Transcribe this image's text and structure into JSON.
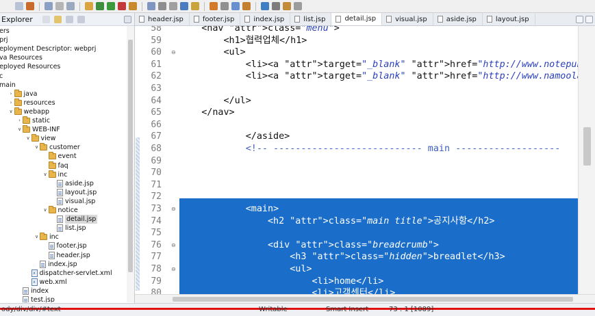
{
  "explorer": {
    "title": "Explorer",
    "tree": [
      {
        "label": "ers",
        "indent": 0,
        "kind": "none"
      },
      {
        "label": "prj",
        "indent": 0,
        "kind": "none"
      },
      {
        "label": "eployment Descriptor: webprj",
        "indent": 0,
        "kind": "none"
      },
      {
        "label": "va Resources",
        "indent": 0,
        "kind": "none"
      },
      {
        "label": "eployed Resources",
        "indent": 0,
        "kind": "none"
      },
      {
        "label": "c",
        "indent": 0,
        "kind": "none"
      },
      {
        "label": "main",
        "indent": 0,
        "kind": "none"
      },
      {
        "label": "java",
        "indent": 1,
        "kind": "folder"
      },
      {
        "label": "resources",
        "indent": 1,
        "kind": "folder"
      },
      {
        "label": "webapp",
        "indent": 1,
        "kind": "folder-open"
      },
      {
        "label": "static",
        "indent": 2,
        "kind": "folder"
      },
      {
        "label": "WEB-INF",
        "indent": 2,
        "kind": "folder-open"
      },
      {
        "label": "view",
        "indent": 3,
        "kind": "folder-open"
      },
      {
        "label": "customer",
        "indent": 4,
        "kind": "folder-open"
      },
      {
        "label": "event",
        "indent": 5,
        "kind": "folder-leaf"
      },
      {
        "label": "faq",
        "indent": 5,
        "kind": "folder-leaf"
      },
      {
        "label": "inc",
        "indent": 5,
        "kind": "folder-open"
      },
      {
        "label": "aside.jsp",
        "indent": 6,
        "kind": "file"
      },
      {
        "label": "layout.jsp",
        "indent": 6,
        "kind": "file"
      },
      {
        "label": "visual.jsp",
        "indent": 6,
        "kind": "file"
      },
      {
        "label": "notice",
        "indent": 5,
        "kind": "folder-open"
      },
      {
        "label": "detail.jsp",
        "indent": 6,
        "kind": "file",
        "selected": true
      },
      {
        "label": "list.jsp",
        "indent": 6,
        "kind": "file"
      },
      {
        "label": "inc",
        "indent": 4,
        "kind": "folder-open"
      },
      {
        "label": "footer.jsp",
        "indent": 5,
        "kind": "file"
      },
      {
        "label": "header.jsp",
        "indent": 5,
        "kind": "file"
      },
      {
        "label": "index.jsp",
        "indent": 4,
        "kind": "file"
      },
      {
        "label": "dispatcher-servlet.xml",
        "indent": 3,
        "kind": "xml"
      },
      {
        "label": "web.xml",
        "indent": 3,
        "kind": "xml"
      },
      {
        "label": "index",
        "indent": 2,
        "kind": "file"
      },
      {
        "label": "test.jsp",
        "indent": 2,
        "kind": "file"
      }
    ]
  },
  "tabs": [
    {
      "label": "header.jsp"
    },
    {
      "label": "footer.jsp"
    },
    {
      "label": "index.jsp"
    },
    {
      "label": "list.jsp"
    },
    {
      "label": "detail.jsp",
      "active": true
    },
    {
      "label": "visual.jsp"
    },
    {
      "label": "aside.jsp"
    },
    {
      "label": "layout.jsp"
    }
  ],
  "editor": {
    "lines": [
      {
        "num": "58",
        "text": "    <nav class=\"menu\">"
      },
      {
        "num": "59",
        "text": "        <h1>협력업체</h1>"
      },
      {
        "num": "60",
        "text": "        <ul>",
        "fold": true
      },
      {
        "num": "61",
        "text": "            <li><a target=\"_blank\" href=\"http://www.notepubs.com\"><im"
      },
      {
        "num": "62",
        "text": "            <li><a target=\"_blank\" href=\"http://www.namoolab.com\"><im"
      },
      {
        "num": "63",
        "text": ""
      },
      {
        "num": "64",
        "text": "        </ul>"
      },
      {
        "num": "65",
        "text": "    </nav>"
      },
      {
        "num": "66",
        "text": ""
      },
      {
        "num": "67",
        "text": "            </aside>"
      },
      {
        "num": "68",
        "text": "            <!-- --------------------------- main -------------------"
      },
      {
        "num": "69",
        "text": ""
      },
      {
        "num": "70",
        "text": ""
      },
      {
        "num": "71",
        "text": ""
      },
      {
        "num": "72",
        "text": ""
      },
      {
        "num": "73",
        "text": "            <main>",
        "fold": true,
        "selected": true
      },
      {
        "num": "74",
        "text": "                <h2 class=\"main title\">공지사항</h2>",
        "selected": true
      },
      {
        "num": "75",
        "text": "",
        "selected": true
      },
      {
        "num": "76",
        "text": "                <div class=\"breadcrumb\">",
        "fold": true,
        "selected": true
      },
      {
        "num": "77",
        "text": "                    <h3 class=\"hidden\">breadlet</h3>",
        "selected": true
      },
      {
        "num": "78",
        "text": "                    <ul>",
        "fold": true,
        "selected": true
      },
      {
        "num": "79",
        "text": "                        <li>home</li>",
        "selected": true
      },
      {
        "num": "80",
        "text": "                        <li>고객센터</li>",
        "selected": true
      }
    ]
  },
  "status": {
    "path": "ody/div/div/#text",
    "mode": "Writable",
    "insert": "Smart Insert",
    "position": "73 : 1 [1089]"
  },
  "colors": {
    "selection": "#1a6ec9",
    "recording_bar": "#e01010"
  }
}
